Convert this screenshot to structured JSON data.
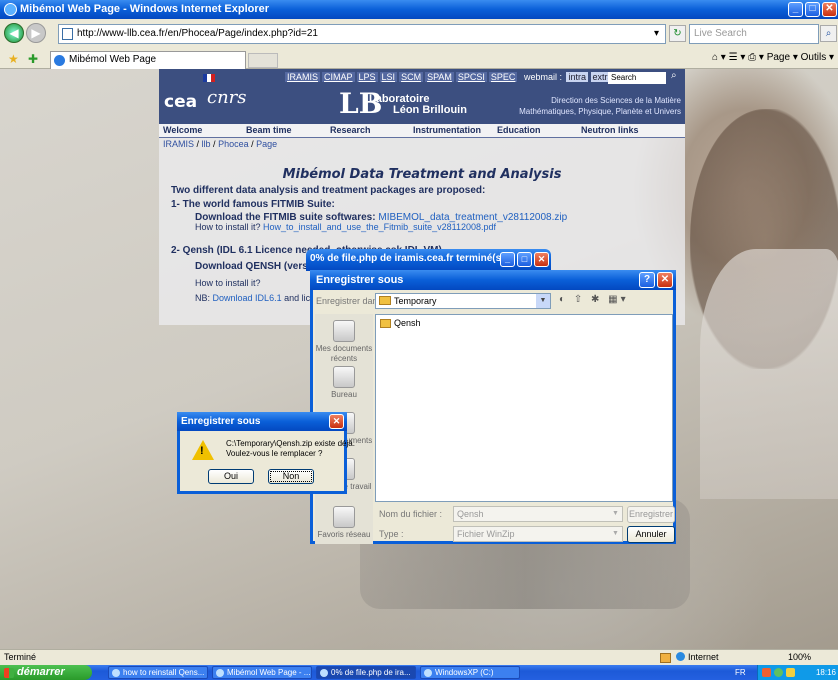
{
  "window": {
    "title": "Mibémol Web Page - Windows Internet Explorer",
    "minimize": "_",
    "maximize": "□",
    "close": "✕"
  },
  "address": {
    "url": "http://www-llb.cea.fr/en/Phocea/Page/index.php?id=21",
    "dropdown": "▾",
    "refresh": "↻",
    "stop": "✕",
    "search_placeholder": "Live Search",
    "search_go": "⌕"
  },
  "tabs": {
    "active_label": "Mibémol Web Page",
    "commands": "⌂ ▾  ☰ ▾  ⎙ ▾  Page ▾  Outils ▾"
  },
  "site": {
    "top_links": [
      "IRAMIS",
      "CIMAP",
      "LPS",
      "LSI",
      "SCM",
      "SPAM",
      "SPCSI",
      "SPEC"
    ],
    "webmail_label": "webmail :",
    "webmail_links": [
      "intra",
      "extra"
    ],
    "search_label": "Search",
    "logo_cea": "cea",
    "logo_cnrs": "cnrs",
    "logo_llb": "LB",
    "lab_name_1": "Laboratoire",
    "lab_name_2": "Léon Brillouin",
    "direction_1": "Direction des Sciences de la Matière",
    "direction_2": "Mathématiques, Physique, Planète et Univers",
    "menu": [
      "Welcome",
      "Beam time",
      "Research",
      "Instrumentation",
      "Education",
      "Neutron links"
    ],
    "breadcrumb": [
      "IRAMIS",
      "llb",
      "Phocea",
      "Page"
    ],
    "breadcrumb_sep": " / ",
    "page_title": "Mibémol Data Treatment and Analysis",
    "intro": "Two different data analysis and treatment packages are proposed:",
    "section1": "1- The world famous FITMIB Suite:",
    "download1_label": "Download the FITMIB suite softwares:",
    "download1_link": "MIBEMOL_data_treatment_v28112008.zip",
    "install1_label": "How to install it?",
    "install1_link": "How_to_install_and_use_the_Fitmib_suite_v28112008.pdf",
    "section2": "2- Qensh (IDL 6.1 Licence needed, otherwise ask IDL VM)",
    "download2": "Download QENSH (version",
    "install2": "How to install it?",
    "nb_label": "NB:",
    "nb_link": "Download IDL6.1",
    "nb_rest": "and lice"
  },
  "progress": {
    "title": "0% de file.php de iramis.cea.fr terminé(s)"
  },
  "save_dialog": {
    "title": "Enregistrer sous",
    "help": "?",
    "close": "✕",
    "save_in_label": "Enregistrer dans :",
    "folder": "Temporary",
    "toolbar_icons": "◐ ⇧ ✱ ▦▾",
    "places": [
      "Mes documents récents",
      "Bureau",
      "Mes documents",
      "Poste de travail",
      "Favoris réseau"
    ],
    "files": [
      "Qensh"
    ],
    "filename_label": "Nom du fichier :",
    "filename_value": "Qensh",
    "type_label": "Type :",
    "type_value": "Fichier WinZip",
    "save_button": "Enregistrer",
    "cancel_button": "Annuler"
  },
  "confirm_dialog": {
    "title": "Enregistrer sous",
    "close": "✕",
    "message_1": "C:\\Temporary\\Qensh.zip existe déjà.",
    "message_2": "Voulez-vous le remplacer ?",
    "yes": "Oui",
    "no": "Non"
  },
  "status": {
    "text": "Terminé",
    "zone": "Internet",
    "zoom": "100%"
  },
  "taskbar": {
    "start": "démarrer",
    "tasks": [
      "how to reinstall Qens...",
      "Mibémol Web Page - ...",
      "0% de file.php de ira...",
      "WindowsXP (C:)"
    ],
    "lang": "FR",
    "clock": "18:16"
  }
}
